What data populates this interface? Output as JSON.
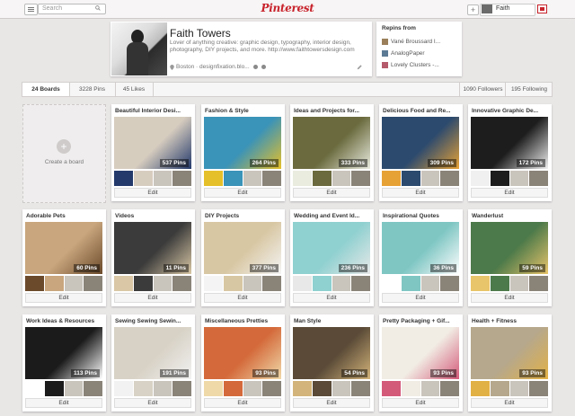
{
  "header": {
    "search_placeholder": "Search",
    "logo": "Pinterest",
    "add_symbol": "+",
    "user_name": "Faith",
    "brand_color": "#c8232c"
  },
  "profile": {
    "name": "Faith Towers",
    "bio": "Lover of anything creative: graphic design, typography, interior design, photography, DIY projects, and more. http://www.faithtowersdesign.com",
    "location": "Boston · designfixation.blo..."
  },
  "repins": {
    "title": "Repins from",
    "items": [
      "Vané Broussard I...",
      "AnalogPaper",
      "Lovely Clusters -..."
    ]
  },
  "stats": {
    "boards": "24 Boards",
    "pins": "3228 Pins",
    "likes": "45 Likes",
    "followers": "1090 Followers",
    "following": "195 Following"
  },
  "create_board": {
    "label": "Create a board",
    "symbol": "+"
  },
  "edit_label": "Edit",
  "boards": [
    {
      "title": "Beautiful Interior Desi...",
      "pins": "537 Pins",
      "cover": "#d7cdbf",
      "accent": "#243a6b"
    },
    {
      "title": "Fashion & Style",
      "pins": "264 Pins",
      "cover": "#3a93b8",
      "accent": "#e6c02a"
    },
    {
      "title": "Ideas and Projects for...",
      "pins": "333 Pins",
      "cover": "#6b6a3e",
      "accent": "#e9ecdf"
    },
    {
      "title": "Delicious Food and Re...",
      "pins": "309 Pins",
      "cover": "#2c4a6e",
      "accent": "#e7a236"
    },
    {
      "title": "Innovative Graphic De...",
      "pins": "172 Pins",
      "cover": "#1d1d1d",
      "accent": "#f0f0f0"
    },
    {
      "title": "Adorable Pets",
      "pins": "60 Pins",
      "cover": "#c9a67d",
      "accent": "#6b4a2b"
    },
    {
      "title": "Videos",
      "pins": "11 Pins",
      "cover": "#3b3b3b",
      "accent": "#d9c7a5"
    },
    {
      "title": "DIY Projects",
      "pins": "377 Pins",
      "cover": "#d8c7a3",
      "accent": "#f4f4f4"
    },
    {
      "title": "Wedding and Event Id...",
      "pins": "236 Pins",
      "cover": "#8fd0d0",
      "accent": "#e8e8e8"
    },
    {
      "title": "Inspirational Quotes",
      "pins": "36 Pins",
      "cover": "#7fc6c3",
      "accent": "#ffffff"
    },
    {
      "title": "Wanderlust",
      "pins": "59 Pins",
      "cover": "#4d7a4a",
      "accent": "#e8c46a"
    },
    {
      "title": "Work Ideas & Resources",
      "pins": "113 Pins",
      "cover": "#1b1b1b",
      "accent": "#ffffff"
    },
    {
      "title": "Sewing Sewing Sewin...",
      "pins": "191 Pins",
      "cover": "#d8d2c6",
      "accent": "#f2f2f2"
    },
    {
      "title": "Miscellaneous Pretties",
      "pins": "93 Pins",
      "cover": "#d46a3b",
      "accent": "#f0d9a9"
    },
    {
      "title": "Man Style",
      "pins": "54 Pins",
      "cover": "#5a4a37",
      "accent": "#d3b47a"
    },
    {
      "title": "Pretty Packaging + Gif...",
      "pins": "93 Pins",
      "cover": "#f1ece4",
      "accent": "#d45a7a"
    },
    {
      "title": "Health + Fitness",
      "pins": "93 Pins",
      "cover": "#b6a88c",
      "accent": "#e2b146"
    }
  ]
}
